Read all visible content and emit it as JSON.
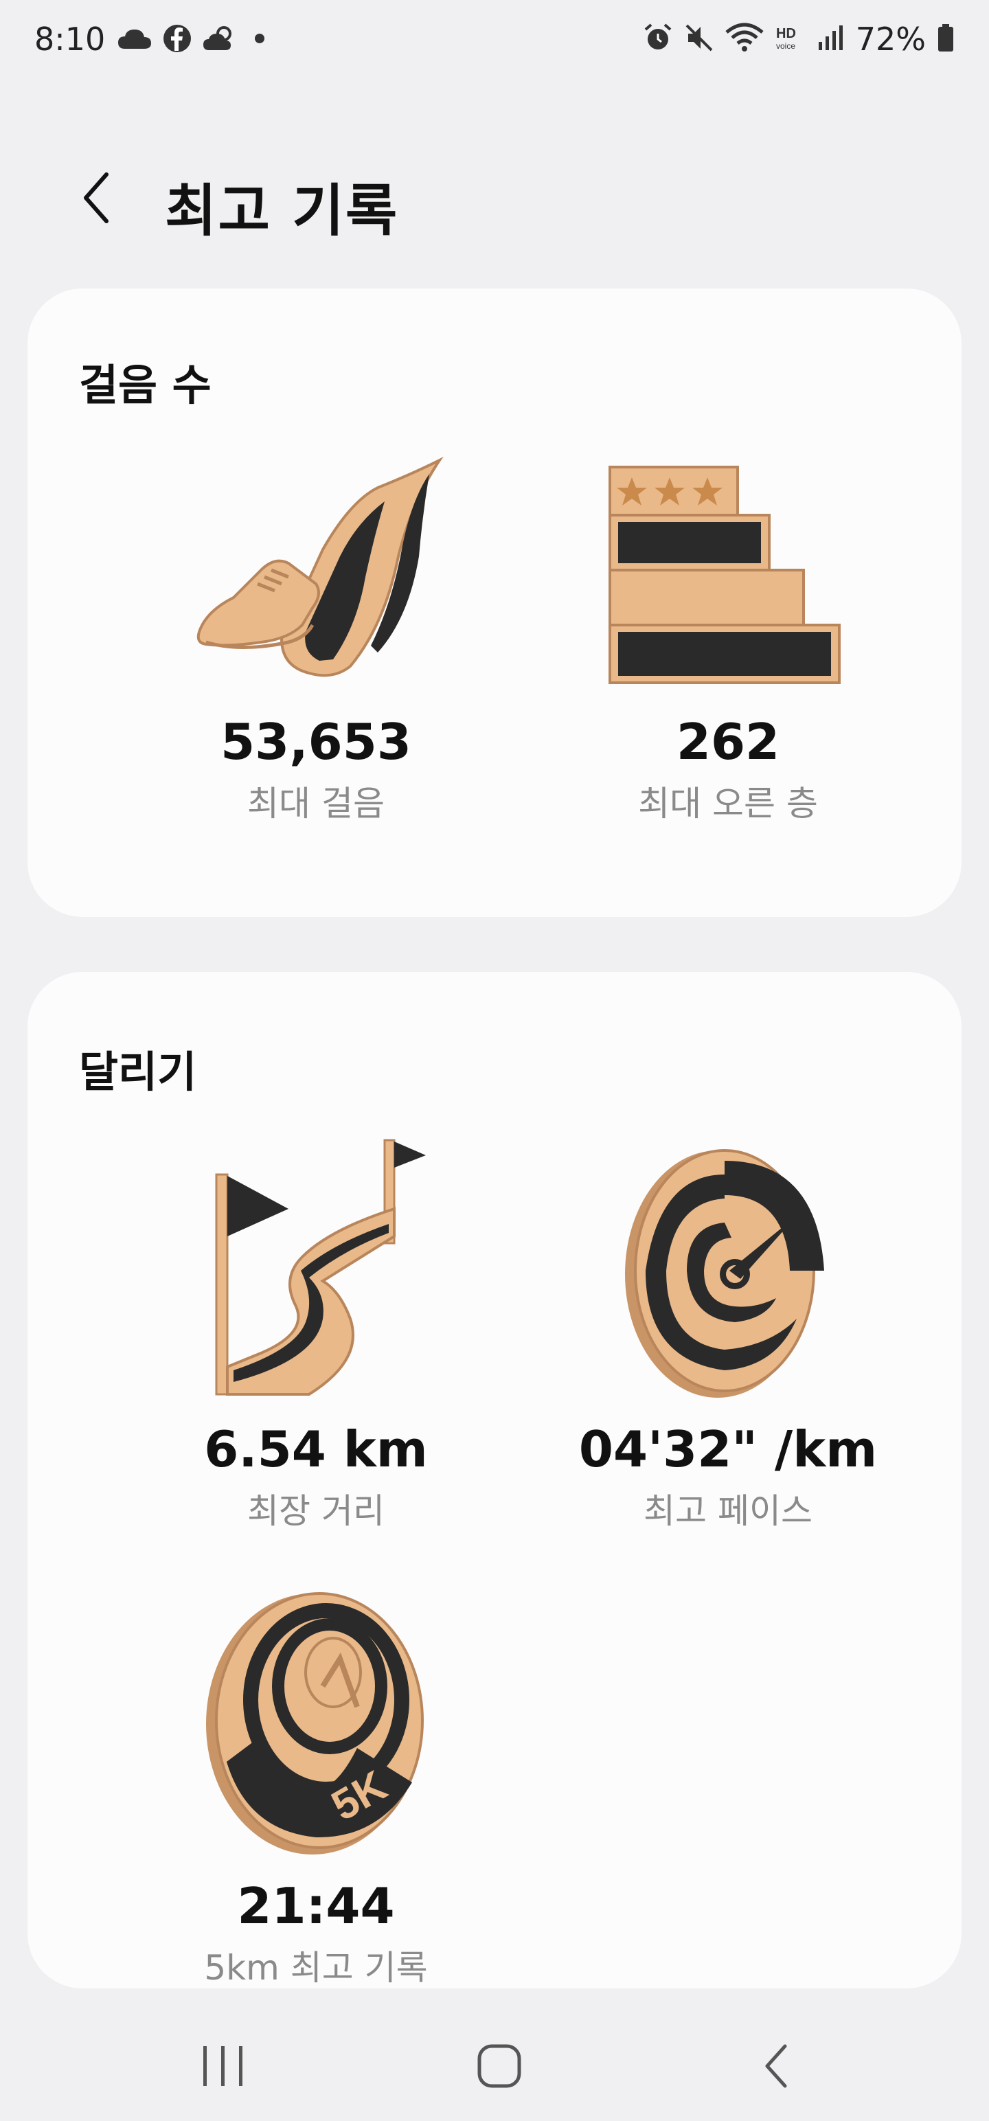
{
  "status_bar": {
    "time": "8:10",
    "battery_percent": "72%",
    "left_icons": [
      "cloud-icon",
      "facebook-icon",
      "weather-icon",
      "dot-icon"
    ],
    "right_icons": [
      "alarm-icon",
      "mute-icon",
      "wifi-icon",
      "hd-voice-icon",
      "signal-icon",
      "battery-icon"
    ]
  },
  "header": {
    "title": "최고 기록"
  },
  "steps_section": {
    "title": "걸음 수",
    "items": [
      {
        "value": "53,653",
        "label": "최대 걸음",
        "icon": "shoe-badge-icon"
      },
      {
        "value": "262",
        "label": "최대 오른 층",
        "icon": "stairs-badge-icon"
      }
    ]
  },
  "running_section": {
    "title": "달리기",
    "items": [
      {
        "value": "6.54 km",
        "label": "최장 거리",
        "icon": "flag-path-badge-icon"
      },
      {
        "value": "04'32\" /km",
        "label": "최고 페이스",
        "icon": "speedometer-badge-icon"
      },
      {
        "value": "21:44",
        "label": "5km 최고 기록",
        "icon": "5k-badge-icon"
      }
    ]
  },
  "colors": {
    "gold": "#e9b98a",
    "gold_dark": "#b9865c",
    "badge_black": "#2a2a2a",
    "label_gray": "#8a8a8a",
    "background": "#f0f0f3",
    "card": "#fcfcfc"
  },
  "nav_bar": {
    "items": [
      "recent-apps-icon",
      "home-icon",
      "back-icon"
    ]
  }
}
